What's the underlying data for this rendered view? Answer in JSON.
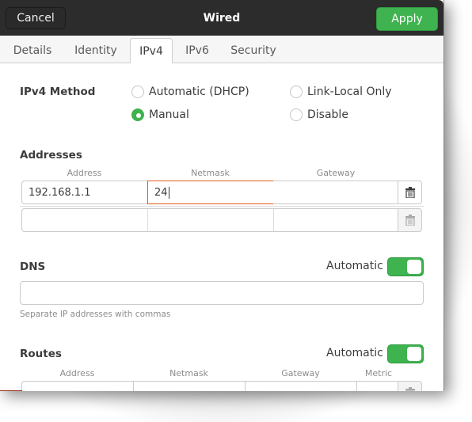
{
  "header": {
    "title": "Wired",
    "cancel_label": "Cancel",
    "apply_label": "Apply"
  },
  "tabs": [
    {
      "label": "Details",
      "active": false
    },
    {
      "label": "Identity",
      "active": false
    },
    {
      "label": "IPv4",
      "active": true
    },
    {
      "label": "IPv6",
      "active": false
    },
    {
      "label": "Security",
      "active": false
    }
  ],
  "ipv4_method": {
    "label": "IPv4 Method",
    "options": [
      {
        "label": "Automatic (DHCP)",
        "selected": false
      },
      {
        "label": "Link-Local Only",
        "selected": false
      },
      {
        "label": "Manual",
        "selected": true
      },
      {
        "label": "Disable",
        "selected": false
      }
    ]
  },
  "addresses": {
    "label": "Addresses",
    "columns": [
      "Address",
      "Netmask",
      "Gateway"
    ],
    "rows": [
      {
        "address": "192.168.1.1",
        "netmask": "24",
        "gateway": ""
      },
      {
        "address": "",
        "netmask": "",
        "gateway": ""
      }
    ]
  },
  "dns": {
    "label": "DNS",
    "automatic_label": "Automatic",
    "automatic_on": true,
    "value": "",
    "hint": "Separate IP addresses with commas"
  },
  "routes": {
    "label": "Routes",
    "automatic_label": "Automatic",
    "automatic_on": true,
    "columns": [
      "Address",
      "Netmask",
      "Gateway",
      "Metric"
    ]
  },
  "colors": {
    "accent_green": "#3eb34f",
    "focus_orange": "#e05a1c",
    "headerbar": "#2c2c2c"
  }
}
